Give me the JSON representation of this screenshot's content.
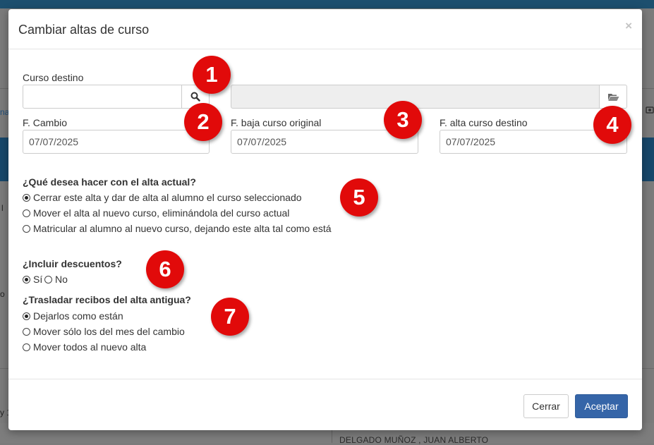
{
  "background": {
    "bottom_name": "DELGADO MUÑOZ , JUAN ALBERTO",
    "fragments": [
      "na",
      "l",
      "o",
      "y 1"
    ]
  },
  "modal": {
    "title": "Cambiar altas de curso",
    "close_label": "×",
    "fields": {
      "curso_destino_label": "Curso destino",
      "curso_destino_value": "",
      "curso_destino_description": "",
      "f_cambio_label": "F. Cambio",
      "f_cambio_value": "07/07/2025",
      "f_baja_label": "F. baja curso original",
      "f_baja_value": "07/07/2025",
      "f_alta_label": "F. alta curso destino",
      "f_alta_value": "07/07/2025"
    },
    "q_alta": {
      "question": "¿Qué desea hacer con el alta actual?",
      "options": [
        "Cerrar este alta y dar de alta al alumno el curso seleccionado",
        "Mover el alta al nuevo curso, eliminándola del curso actual",
        "Matricular al alumno al nuevo curso, dejando este alta tal como está"
      ],
      "selected": 0
    },
    "q_descuentos": {
      "question": "¿Incluir descuentos?",
      "options": [
        "Sí",
        "No"
      ],
      "selected": 0
    },
    "q_recibos": {
      "question": "¿Trasladar recibos del alta antigua?",
      "options": [
        "Dejarlos como están",
        "Mover sólo los del mes del cambio",
        "Mover todos al nuevo alta"
      ],
      "selected": 0
    },
    "footer": {
      "cerrar_label": "Cerrar",
      "aceptar_label": "Aceptar"
    }
  },
  "badges": [
    "1",
    "2",
    "3",
    "4",
    "5",
    "6",
    "7"
  ],
  "colors": {
    "badge": "#e10a0a",
    "primary_button": "#3565a8",
    "overlay": "#7b7b7b"
  },
  "icons": {
    "search": "search-icon",
    "folder": "folder-open-icon",
    "close": "close-icon"
  }
}
